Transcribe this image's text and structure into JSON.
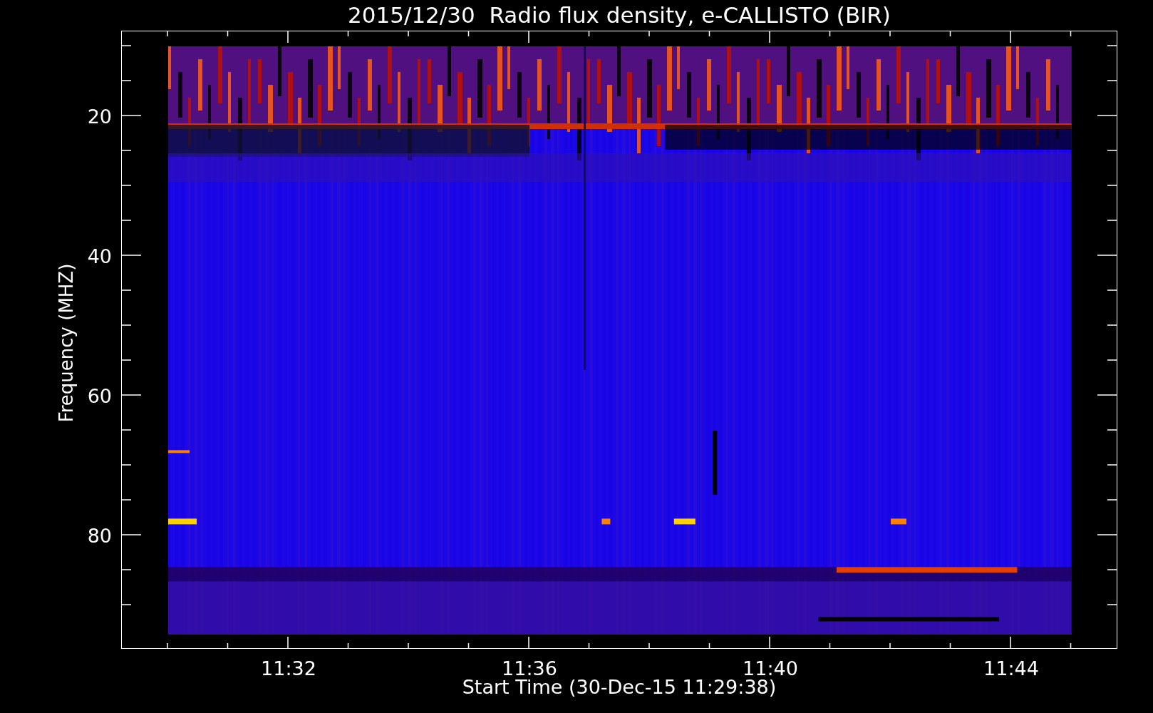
{
  "title": "2015/12/30  Radio flux density, e-CALLISTO (BIR)",
  "y_axis": {
    "label": "Frequency (MHZ)",
    "ticks": [
      "20",
      "40",
      "60",
      "80"
    ]
  },
  "x_axis": {
    "label": "Start Time (30-Dec-15 11:29:38)",
    "ticks": [
      "11:32",
      "11:36",
      "11:40",
      "11:44"
    ]
  }
}
